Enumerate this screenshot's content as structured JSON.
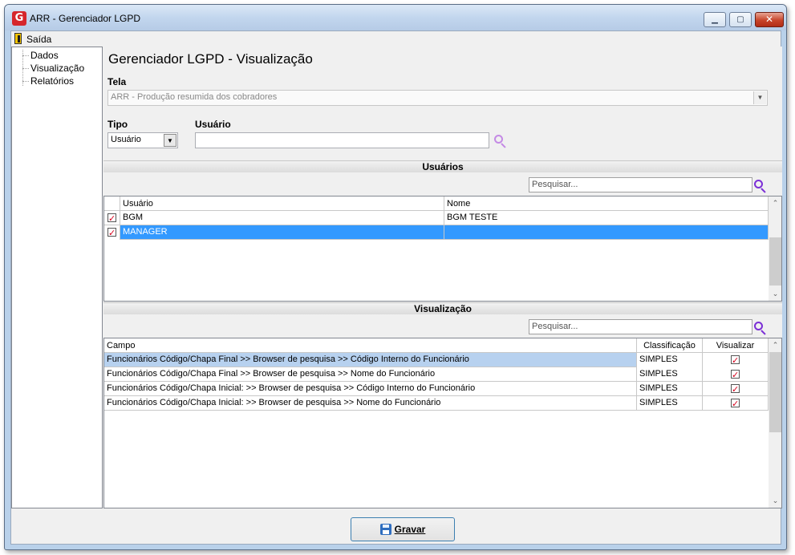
{
  "window": {
    "title": "ARR - Gerenciador LGPD",
    "icon_letter": "G"
  },
  "menu": {
    "exit_label": "Saída"
  },
  "tree": {
    "items": [
      "Dados",
      "Visualização",
      "Relatórios"
    ]
  },
  "main": {
    "title": "Gerenciador LGPD - Visualização",
    "tela_label": "Tela",
    "tela_value": "ARR - Produção resumida dos cobradores",
    "tipo_label": "Tipo",
    "tipo_value": "Usuário",
    "usuario_label": "Usuário",
    "usuario_value": ""
  },
  "users_section": {
    "title": "Usuários",
    "search_placeholder": "Pesquisar...",
    "columns": [
      "Usuário",
      "Nome"
    ],
    "rows": [
      {
        "checked": true,
        "usuario": "BGM",
        "nome": "BGM TESTE",
        "selected": false
      },
      {
        "checked": true,
        "usuario": "MANAGER",
        "nome": "",
        "selected": true
      }
    ]
  },
  "view_section": {
    "title": "Visualização",
    "search_placeholder": "Pesquisar...",
    "columns": [
      "Campo",
      "Classificação",
      "Visualizar"
    ],
    "rows": [
      {
        "campo": "Funcionários Código/Chapa Final >> Browser de pesquisa >> Código Interno do Funcionário",
        "classificacao": "SIMPLES",
        "visualizar": true
      },
      {
        "campo": "Funcionários Código/Chapa Final >> Browser de pesquisa >> Nome do Funcionário",
        "classificacao": "SIMPLES",
        "visualizar": true
      },
      {
        "campo": "Funcionários Código/Chapa Inicial: >> Browser de pesquisa >> Código Interno do Funcionário",
        "classificacao": "SIMPLES",
        "visualizar": true
      },
      {
        "campo": "Funcionários Código/Chapa Inicial: >> Browser de pesquisa >> Nome do Funcionário",
        "classificacao": "SIMPLES",
        "visualizar": true
      }
    ]
  },
  "footer": {
    "save_label": "Gravar"
  },
  "colors": {
    "selection": "#3399ff",
    "highlight": "#b7d1ef",
    "check": "#d8001c",
    "search_icon": "#7b2fd6"
  }
}
